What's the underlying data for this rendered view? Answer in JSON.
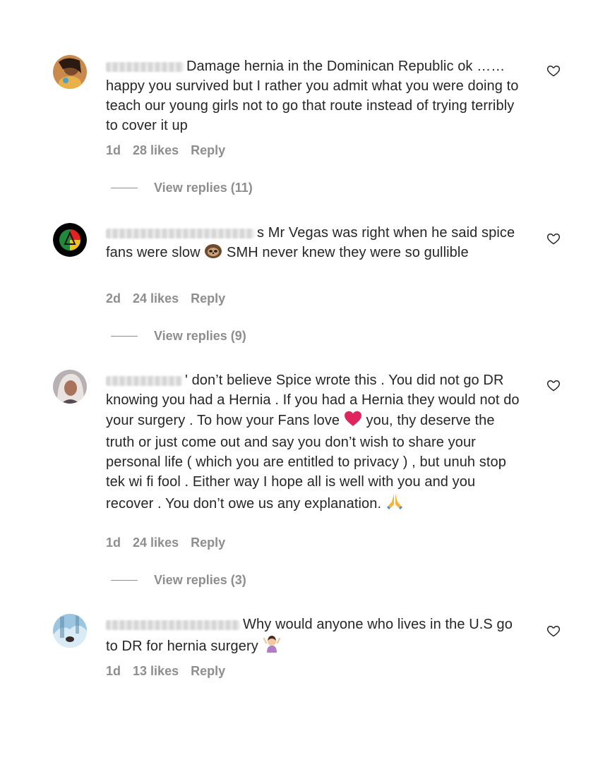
{
  "comments": [
    {
      "text": "Damage hernia in the Dominican Republic ok …… happy you survived but I rather you admit what you were doing to teach our young girls not to go that route instead of trying terribly to cover it up",
      "time": "1d",
      "likes": "28 likes",
      "reply": "Reply",
      "view_replies": "View replies (11)"
    },
    {
      "text_a": "s Mr Vegas was right when he said spice fans were slow",
      "text_b": "SMH never knew they were so gullible",
      "time": "2d",
      "likes": "24 likes",
      "reply": "Reply",
      "view_replies": "View replies (9)"
    },
    {
      "text_a": "' don’t believe Spice wrote this . You did not go DR knowing you had a Hernia . If you had a Hernia they would not do your surgery . To how your Fans love",
      "text_b": "you, thy deserve the truth or just come out and say you don’t wish to share your personal life ( which you are entitled to privacy ) , but unuh stop tek wi fi fool . Either way I hope all is well with you and you recover . You don’t owe us any explanation.",
      "time": "1d",
      "likes": "24 likes",
      "reply": "Reply",
      "view_replies": "View replies (3)"
    },
    {
      "text": "Why would anyone who lives in the U.S go to DR for hernia surgery",
      "time": "1d",
      "likes": "13 likes",
      "reply": "Reply"
    }
  ],
  "icons": {
    "like": "heart-outline-icon",
    "sloth": "sloth-emoji",
    "heart_emoji": "red-heart-emoji",
    "pray": "praying-hands-emoji",
    "shrug": "woman-shrugging-emoji"
  },
  "colors": {
    "text": "#262626",
    "secondary": "#8e8e8e",
    "heart_emoji": "#e0245e"
  }
}
